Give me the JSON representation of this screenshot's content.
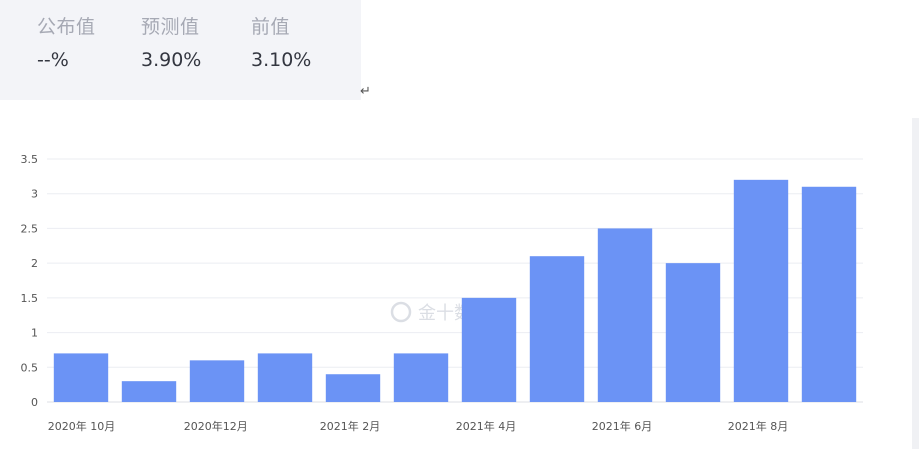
{
  "stats": {
    "published": {
      "label": "公布值",
      "value": "--%"
    },
    "forecast": {
      "label": "预测值",
      "value": "3.90%"
    },
    "previous": {
      "label": "前值",
      "value": "3.10%"
    }
  },
  "return_symbol": "↵",
  "watermark": {
    "text": "金十数据"
  },
  "colors": {
    "bar": "#6b93f5",
    "grid": "#ebedf2",
    "axis_text": "#555555",
    "panel_bg": "#f3f4f8"
  },
  "chart_data": {
    "type": "bar",
    "categories": [
      "2020年 10月",
      "",
      "2020年12月",
      "",
      "2021年 2月",
      "",
      "2021年 4月",
      "",
      "2021年 6月",
      "",
      "2021年 8月",
      ""
    ],
    "values": [
      0.7,
      0.3,
      0.6,
      0.7,
      0.4,
      0.7,
      1.5,
      2.1,
      2.5,
      2.0,
      3.2,
      3.1
    ],
    "y_ticks": [
      "0",
      "0.5",
      "1",
      "1.5",
      "2",
      "2.5",
      "3",
      "3.5"
    ],
    "ylim": [
      0,
      3.5
    ],
    "grid": true,
    "title": "",
    "xlabel": "",
    "ylabel": ""
  }
}
